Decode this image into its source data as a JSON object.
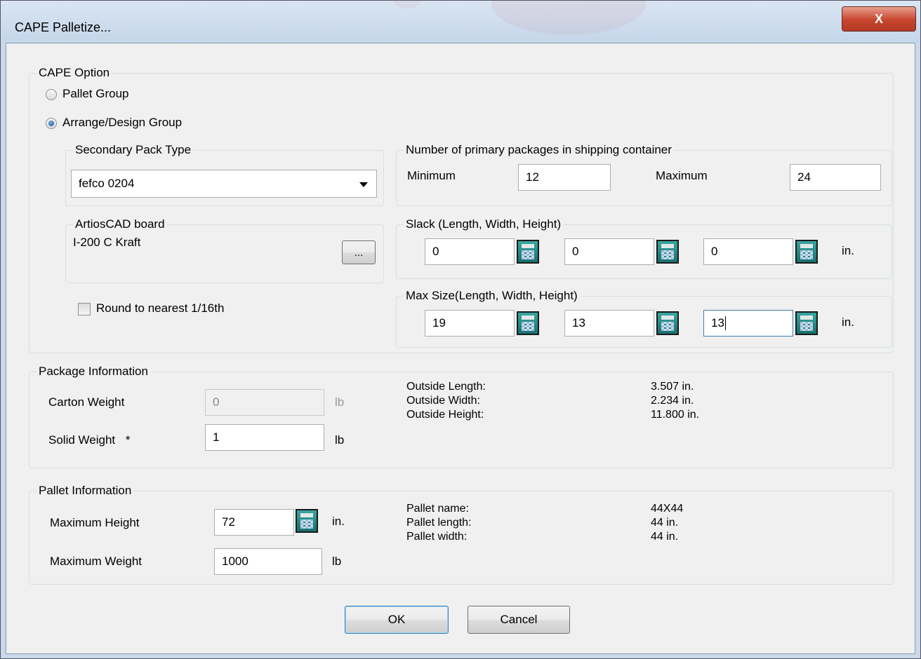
{
  "window": {
    "title": "CAPE Palletize...",
    "close_label": "X"
  },
  "cape_option": {
    "group_label": "CAPE Option",
    "pallet_group": "Pallet Group",
    "arrange_group": "Arrange/Design Group",
    "selected": "arrange"
  },
  "secondary_pack": {
    "label": "Secondary Pack Type",
    "value": "fefco 0204"
  },
  "board": {
    "label": "ArtiosCAD board",
    "value": "I-200 C Kraft",
    "browse_label": "..."
  },
  "round": {
    "label": "Round to nearest 1/16th",
    "checked": false
  },
  "primary_count": {
    "label": "Number of primary packages in shipping container",
    "min_label": "Minimum",
    "min_value": "12",
    "max_label": "Maximum",
    "max_value": "24"
  },
  "slack": {
    "label": "Slack (Length, Width, Height)",
    "length": "0",
    "width": "0",
    "height": "0",
    "unit": "in."
  },
  "max_size": {
    "label": "Max Size(Length, Width, Height)",
    "length": "19",
    "width": "13",
    "height": "13",
    "unit": "in."
  },
  "package": {
    "label": "Package Information",
    "carton_weight_label": "Carton Weight",
    "carton_weight": "0",
    "carton_unit": "lb",
    "solid_weight_label": "Solid Weight",
    "solid_weight_marker": "*",
    "solid_weight": "1",
    "solid_unit": "lb",
    "outside_length_label": "Outside Length:",
    "outside_length": "3.507 in.",
    "outside_width_label": "Outside Width:",
    "outside_width": "2.234 in.",
    "outside_height_label": "Outside Height:",
    "outside_height": "11.800 in."
  },
  "pallet": {
    "label": "Pallet Information",
    "max_height_label": "Maximum Height",
    "max_height": "72",
    "max_height_unit": "in.",
    "max_weight_label": "Maximum Weight",
    "max_weight": "1000",
    "max_weight_unit": "lb",
    "name_label": "Pallet name:",
    "name": "44X44",
    "length_label": "Pallet length:",
    "length": "44 in.",
    "width_label": "Pallet width:",
    "width": "44 in."
  },
  "buttons": {
    "ok": "OK",
    "cancel": "Cancel"
  },
  "colors": {
    "titlebar": "#c4d6ea",
    "close": "#c7442d",
    "calc": "#17706d",
    "backdrop_accent": "#b0263a"
  }
}
